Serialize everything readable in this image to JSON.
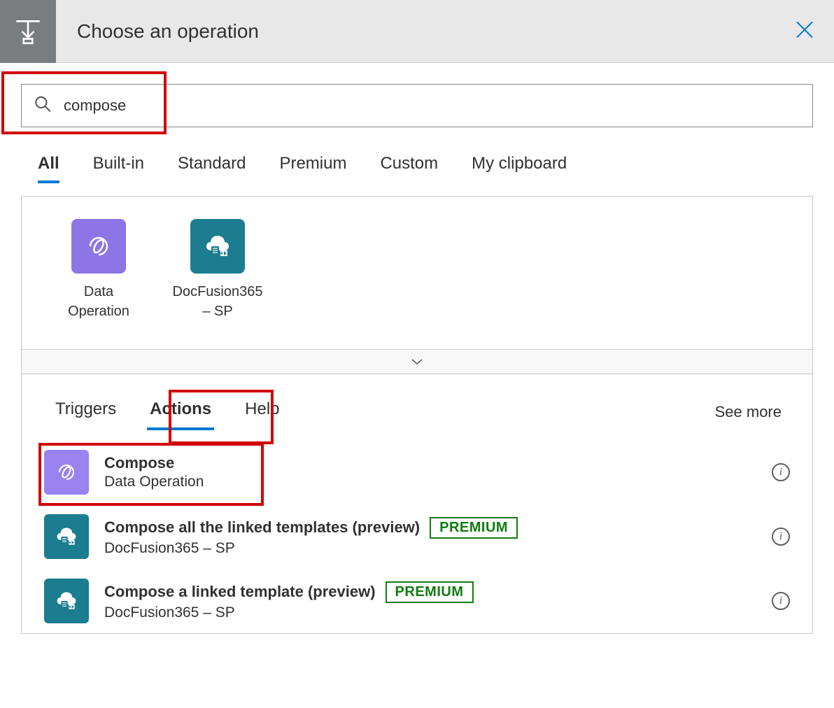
{
  "header": {
    "title": "Choose an operation"
  },
  "search": {
    "value": "compose"
  },
  "tabs": [
    {
      "label": "All",
      "active": true
    },
    {
      "label": "Built-in",
      "active": false
    },
    {
      "label": "Standard",
      "active": false
    },
    {
      "label": "Premium",
      "active": false
    },
    {
      "label": "Custom",
      "active": false
    },
    {
      "label": "My clipboard",
      "active": false
    }
  ],
  "connectors": [
    {
      "label": "Data Operation",
      "icon": "data-operation",
      "color": "purple"
    },
    {
      "label": "DocFusion365 – SP",
      "icon": "docfusion",
      "color": "teal"
    }
  ],
  "subtabs": [
    {
      "label": "Triggers",
      "active": false
    },
    {
      "label": "Actions",
      "active": true
    },
    {
      "label": "Help",
      "active": false
    }
  ],
  "seeMore": "See more",
  "actions": [
    {
      "title": "Compose",
      "subtitle": "Data Operation",
      "icon": "data-operation",
      "color": "purple",
      "badge": null,
      "highlighted": true
    },
    {
      "title": "Compose all the linked templates (preview)",
      "subtitle": "DocFusion365 – SP",
      "icon": "docfusion",
      "color": "teal",
      "badge": "PREMIUM"
    },
    {
      "title": "Compose a linked template (preview)",
      "subtitle": "DocFusion365 – SP",
      "icon": "docfusion",
      "color": "teal",
      "badge": "PREMIUM"
    }
  ]
}
